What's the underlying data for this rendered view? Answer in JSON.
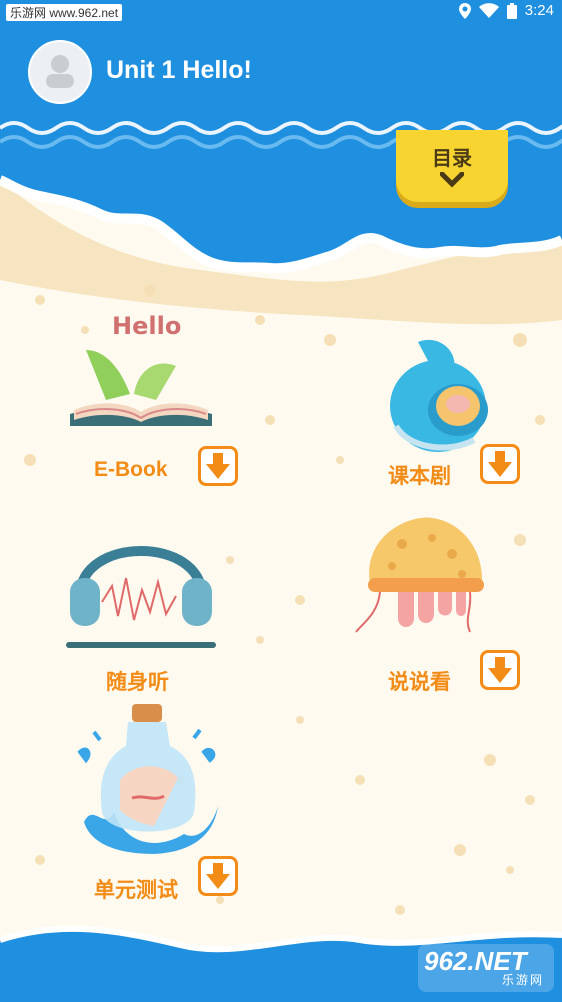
{
  "status_bar": {
    "watermark": "乐游网 www.962.net",
    "time": "3:24",
    "icons": [
      "location-icon",
      "wifi-icon",
      "battery-icon"
    ]
  },
  "header": {
    "title": "Unit 1 Hello!",
    "avatar_icon": "user-avatar-icon",
    "menu_label": "目录",
    "menu_icon": "chevron-down-icon"
  },
  "items": [
    {
      "label": "E-Book",
      "illustration": "open-book-icon",
      "illustration_text": "Hello",
      "has_download": true,
      "download_icon": "download-arrow-icon"
    },
    {
      "label": "课本剧",
      "illustration": "seashell-icon",
      "has_download": true,
      "download_icon": "download-arrow-icon"
    },
    {
      "label": "随身听",
      "illustration": "headphones-icon",
      "has_download": false
    },
    {
      "label": "说说看",
      "illustration": "jellyfish-icon",
      "has_download": true,
      "download_icon": "download-arrow-icon"
    },
    {
      "label": "单元测试",
      "illustration": "message-bottle-icon",
      "has_download": true,
      "download_icon": "download-arrow-icon"
    }
  ],
  "watermark": {
    "top": "962.NET",
    "bottom": "乐游网"
  },
  "colors": {
    "sky": "#1f8fe0",
    "sand": "#f6e5c0",
    "accent": "#f28c16",
    "tab": "#f8d431"
  }
}
